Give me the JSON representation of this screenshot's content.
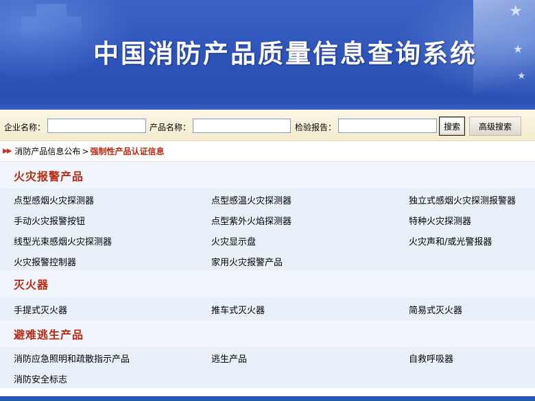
{
  "banner": {
    "title": "中国消防产品质量信息查询系统"
  },
  "search": {
    "company_label": "企业名称：",
    "product_label": "产品名称：",
    "report_label": "检验报告：",
    "company_value": "",
    "product_value": "",
    "report_value": "",
    "search_button": "搜索",
    "advanced_button": "高级搜索"
  },
  "breadcrumb": {
    "arrows": "▶▶",
    "parent": "消防产品信息公布",
    "separator": ">",
    "current": "强制性产品认证信息"
  },
  "sections": [
    {
      "title": "火灾报警产品",
      "rows": [
        [
          "点型感烟火灾探测器",
          "点型感温火灾探测器",
          "独立式感烟火灾探测报警器"
        ],
        [
          "手动火灾报警按钮",
          "点型紫外火焰探测器",
          "特种火灾探测器"
        ],
        [
          "线型光束感烟火灾探测器",
          "火灾显示盘",
          "火灾声和/或光警报器"
        ],
        [
          "火灾报警控制器",
          "家用火灾报警产品",
          ""
        ]
      ]
    },
    {
      "title": "灭火器",
      "rows": [
        [
          "手提式灭火器",
          "推车式灭火器",
          "简易式灭火器"
        ]
      ]
    },
    {
      "title": "避难逃生产品",
      "rows": [
        [
          "消防应急照明和疏散指示产品",
          "逃生产品",
          "自救呼吸器"
        ],
        [
          "消防安全标志",
          "",
          ""
        ]
      ]
    }
  ],
  "colors": {
    "banner_blue": "#2f55bb",
    "section_title_red": "#b8290f",
    "row_background": "#e9f0f9",
    "search_bar_bg": "#f4ecd0"
  }
}
